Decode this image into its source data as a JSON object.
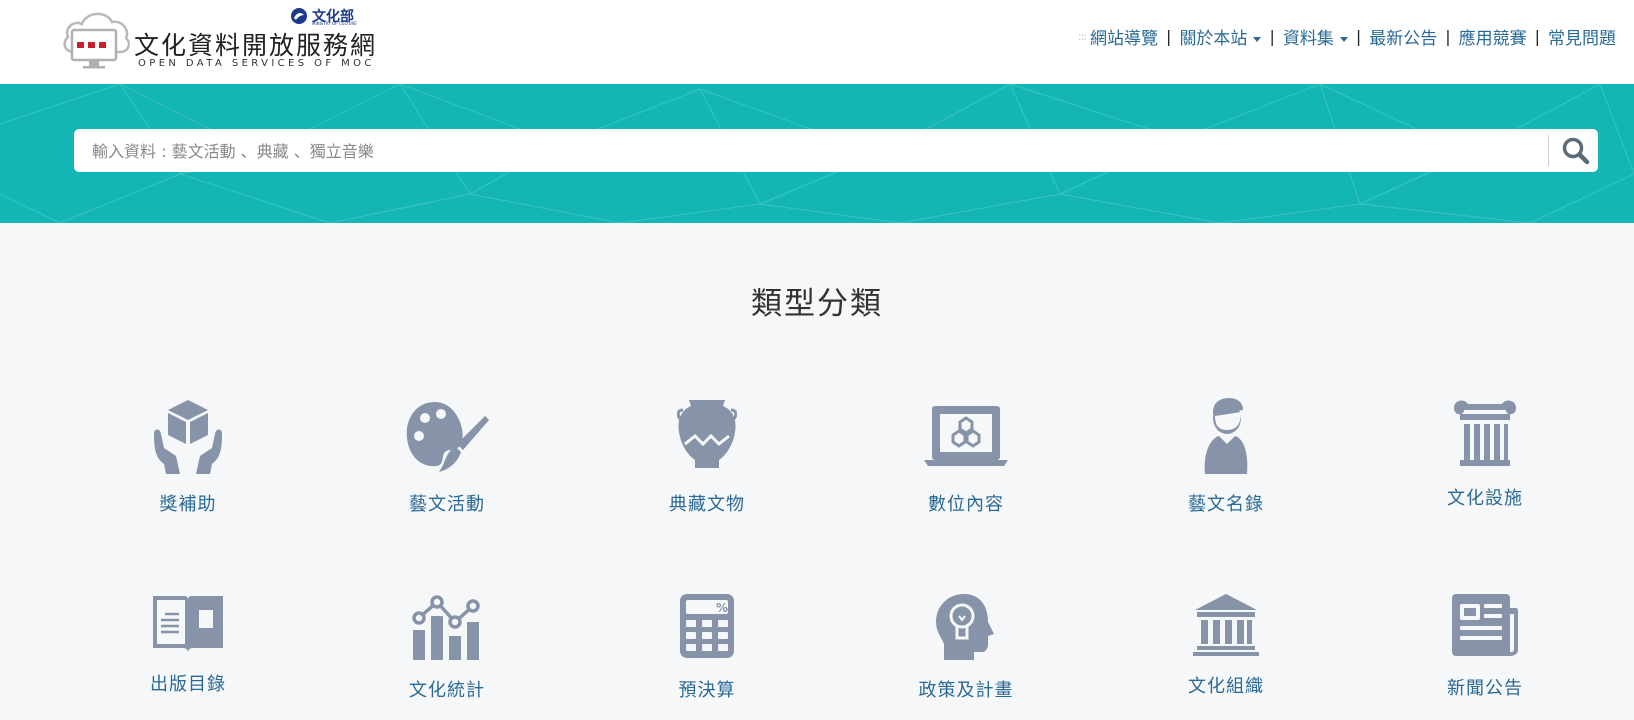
{
  "header": {
    "site_title": "文化資料開放服務網",
    "site_subtitle": "OPEN DATA SERVICES OF MOC",
    "ministry_label": "文化部",
    "ministry_small": "MINISTRY OF CULTURE"
  },
  "nav": {
    "dots": ":::",
    "items": [
      {
        "label": "網站導覽"
      },
      {
        "label": "關於本站",
        "dropdown": true
      },
      {
        "label": "資料集",
        "dropdown": true
      },
      {
        "label": "最新公告"
      },
      {
        "label": "應用競賽"
      },
      {
        "label": "常見問題"
      }
    ]
  },
  "search": {
    "placeholder": "輸入資料 : 藝文活動 、典藏 、獨立音樂",
    "value": ""
  },
  "colors": {
    "banner": "#13b5b5",
    "icon": "#8793a8",
    "link": "#2a6a96"
  },
  "main": {
    "section_title": "類型分類",
    "categories": [
      {
        "label": "獎補助",
        "icon": "hands-box-icon"
      },
      {
        "label": "藝文活動",
        "icon": "palette-icon"
      },
      {
        "label": "典藏文物",
        "icon": "vase-icon"
      },
      {
        "label": "數位內容",
        "icon": "laptop-icon"
      },
      {
        "label": "藝文名錄",
        "icon": "person-icon"
      },
      {
        "label": "文化設施",
        "icon": "column-icon"
      },
      {
        "label": "出版目錄",
        "icon": "book-icon"
      },
      {
        "label": "文化統計",
        "icon": "chart-icon"
      },
      {
        "label": "預決算",
        "icon": "calculator-icon"
      },
      {
        "label": "政策及計畫",
        "icon": "head-bulb-icon"
      },
      {
        "label": "文化組織",
        "icon": "institution-icon"
      },
      {
        "label": "新聞公告",
        "icon": "newspaper-icon"
      }
    ]
  }
}
